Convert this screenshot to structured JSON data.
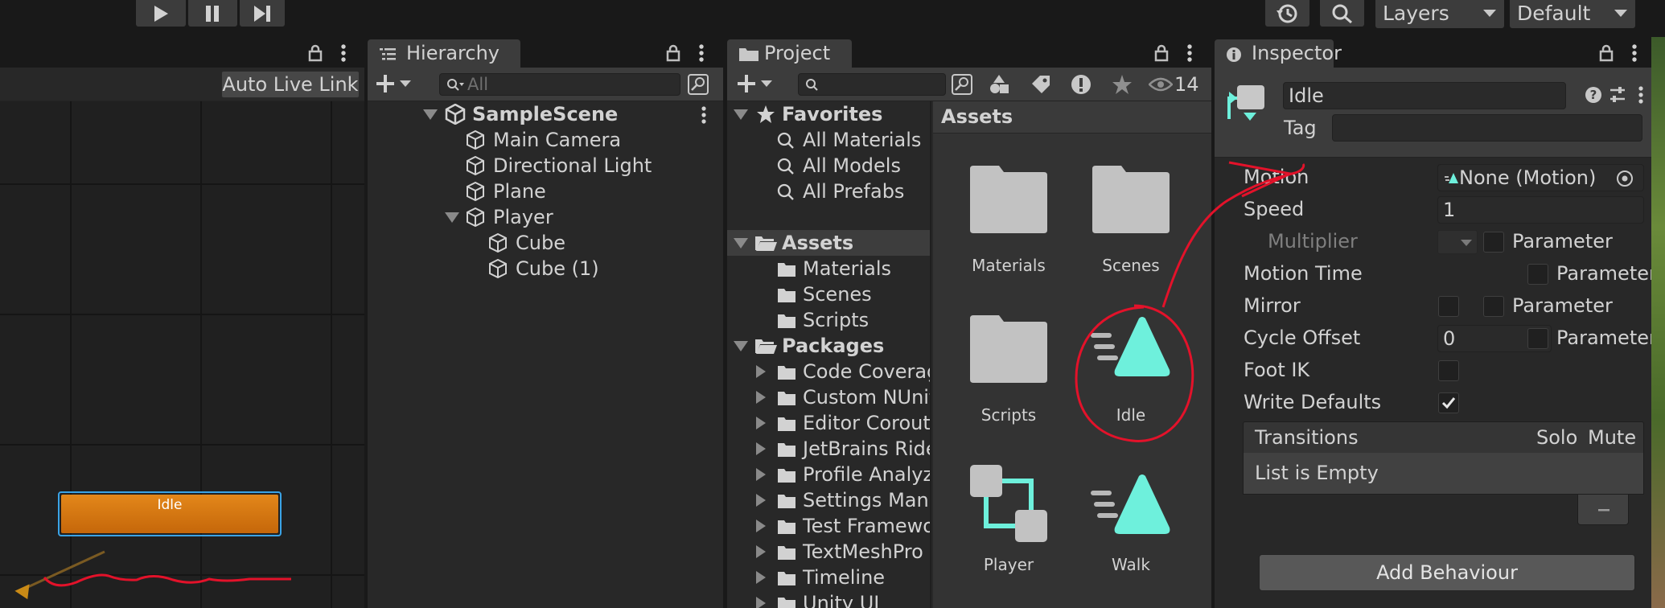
{
  "toolbar": {
    "layers_label": "Layers",
    "layout_label": "Default"
  },
  "animator": {
    "auto_live_link": "Auto Live Link",
    "state_node_label": "Idle"
  },
  "hierarchy": {
    "tab_label": "Hierarchy",
    "search_placeholder": "All",
    "scene_name": "SampleScene",
    "items": [
      "Main Camera",
      "Directional Light",
      "Plane",
      "Player",
      "Cube",
      "Cube (1)"
    ]
  },
  "project": {
    "tab_label": "Project",
    "hidden_count": "14",
    "favorites_label": "Favorites",
    "favorites": [
      "All Materials",
      "All Models",
      "All Prefabs"
    ],
    "assets_label": "Assets",
    "asset_folders": [
      "Materials",
      "Scenes",
      "Scripts"
    ],
    "packages_label": "Packages",
    "packages": [
      "Code Coverag",
      "Custom NUnit",
      "Editor Coroutir",
      "JetBrains Ride",
      "Profile Analyz",
      "Settings Mana",
      "Test Framewo",
      "TextMeshPro",
      "Timeline",
      "Unity UI"
    ],
    "grid_header": "Assets",
    "grid_items": [
      "Materials",
      "Scenes",
      "Scripts",
      "Idle",
      "Player",
      "Walk"
    ]
  },
  "inspector": {
    "tab_label": "Inspector",
    "object_name": "Idle",
    "tag_label": "Tag",
    "tag_value": "",
    "motion_label": "Motion",
    "motion_value": "None (Motion)",
    "speed_label": "Speed",
    "speed_value": "1",
    "multiplier_label": "Multiplier",
    "parameter_label": "Parameter",
    "motion_time_label": "Motion Time",
    "mirror_label": "Mirror",
    "cycle_offset_label": "Cycle Offset",
    "cycle_offset_value": "0",
    "foot_ik_label": "Foot IK",
    "write_defaults_label": "Write Defaults",
    "write_defaults_checked": true,
    "transitions_header": "Transitions",
    "solo_label": "Solo",
    "mute_label": "Mute",
    "list_empty": "List is Empty",
    "add_behaviour_label": "Add Behaviour"
  },
  "colors": {
    "panel_bg": "#282828",
    "toolbar_bg": "#191919",
    "tab_bg": "#3c3c3c",
    "node_orange": "#d97b0f",
    "accent_teal": "#6ef0dc",
    "annotation_red": "#e3122a"
  }
}
